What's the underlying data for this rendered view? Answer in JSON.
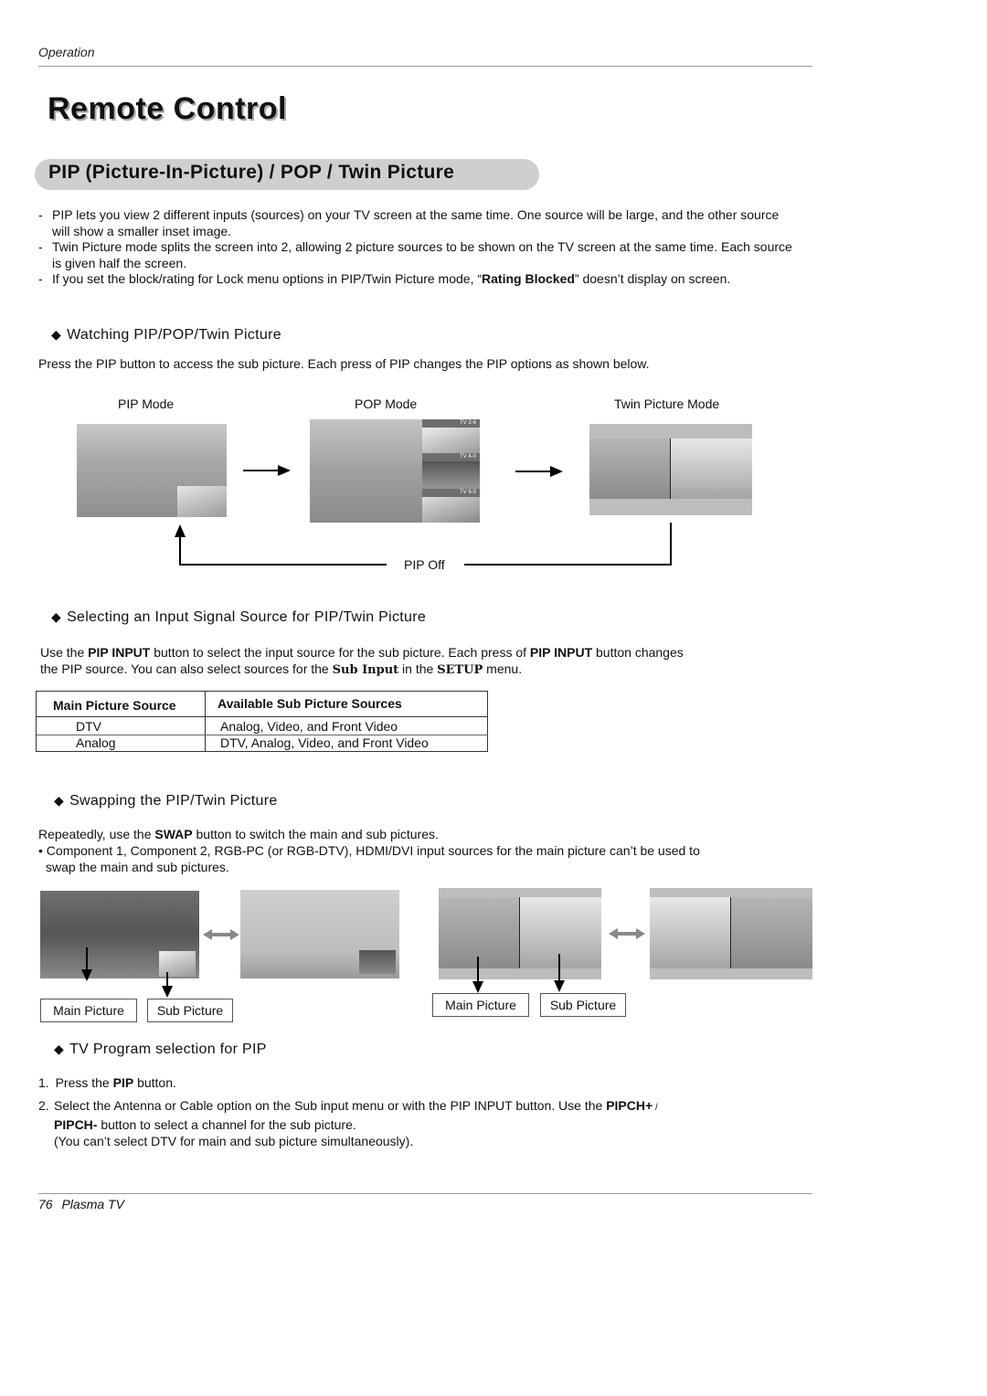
{
  "header": {
    "section_label": "Operation"
  },
  "page_title": "Remote Control",
  "section_title": "PIP (Picture-In-Picture) / POP / Twin Picture",
  "intro_bullets": [
    {
      "text": "PIP lets you view 2 different inputs (sources) on your TV screen at the same time. One source will be large, and the other source will show a smaller inset image."
    },
    {
      "text": "Twin Picture mode splits the screen into 2, allowing 2 picture sources to be shown on the TV screen at the same time. Each source is given half the screen."
    },
    {
      "pre": "If you set the block/rating for Lock menu options in PIP/Twin Picture mode, “",
      "bold": "Rating Blocked",
      "post": "” doesn’t display on screen."
    }
  ],
  "watching": {
    "heading": "Watching PIP/POP/Twin Picture",
    "body": "Press the PIP button to access the sub picture. Each press of PIP changes the PIP options as shown below.",
    "modes": [
      "PIP Mode",
      "POP Mode",
      "Twin Picture Mode"
    ],
    "pop_channels": [
      "TV 2-6",
      "TV 4-0",
      "TV 6-0"
    ],
    "pip_off_label": "PIP Off"
  },
  "selecting": {
    "heading": "Selecting an Input Signal Source for PIP/Twin Picture",
    "body_1_pre": "Use the ",
    "body_1_bold1": "PIP INPUT",
    "body_1_mid": " button to select the input source for the sub picture. Each press of ",
    "body_1_bold2": "PIP INPUT",
    "body_1_post": " button changes",
    "body_2_pre": "the PIP source. You can also select sources for the ",
    "body_2_menu1": "Sub Input",
    "body_2_mid": " in the ",
    "body_2_menu2": "SETUP",
    "body_2_post": " menu.",
    "table": {
      "headers": [
        "Main Picture Source",
        "Available Sub Picture Sources"
      ],
      "rows": [
        [
          "DTV",
          "Analog, Video, and Front Video"
        ],
        [
          "Analog",
          "DTV, Analog, Video, and Front Video"
        ]
      ]
    }
  },
  "swapping": {
    "heading": "Swapping the PIP/Twin Picture",
    "body_pre": "Repeatedly, use the ",
    "body_bold": "SWAP",
    "body_post": " button to switch the main and sub pictures.",
    "note_1": "• Component 1, Component 2, RGB-PC (or RGB-DTV), HDMI/DVI input sources for the main picture can’t be used to",
    "note_2": "swap the main and sub pictures.",
    "labels": {
      "main": "Main Picture",
      "sub": "Sub Picture"
    }
  },
  "tv_program": {
    "heading": "TV Program selection for PIP",
    "step1_num": "1.",
    "step1_pre": "Press the ",
    "step1_bold": "PIP",
    "step1_post": " button.",
    "step2_num": "2.",
    "step2_line1_pre": "Select the Antenna or Cable option on the Sub input menu or with the PIP INPUT button. Use the ",
    "step2_line1_bold": "PIPCH+",
    "step2_line1_post": " /",
    "step2_line2_bold": "PIPCH-",
    "step2_line2_post": " button to select a channel for the sub picture.",
    "step2_line3": "(You can’t select DTV for main and sub picture simultaneously)."
  },
  "footer": {
    "page_number": "76",
    "product": "Plasma TV"
  },
  "icons": {
    "diamond": "◆"
  }
}
